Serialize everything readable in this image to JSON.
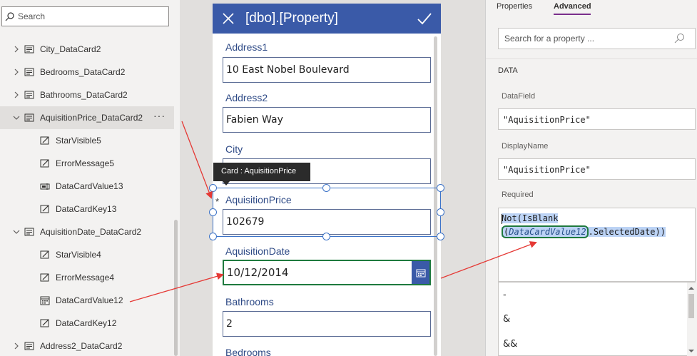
{
  "tree": {
    "search_placeholder": "Search",
    "items": [
      {
        "label": "City_DataCard2",
        "icon": "card-icon"
      },
      {
        "label": "Bedrooms_DataCard2",
        "icon": "card-icon"
      },
      {
        "label": "Bathrooms_DataCard2",
        "icon": "card-icon"
      },
      {
        "label": "AquisitionPrice_DataCard2",
        "icon": "card-icon",
        "selected": true,
        "more": "···"
      },
      {
        "label": "StarVisible5",
        "icon": "edit-label-icon"
      },
      {
        "label": "ErrorMessage5",
        "icon": "edit-label-icon"
      },
      {
        "label": "DataCardValue13",
        "icon": "text-input-icon"
      },
      {
        "label": "DataCardKey13",
        "icon": "edit-label-icon"
      },
      {
        "label": "AquisitionDate_DataCard2",
        "icon": "card-icon"
      },
      {
        "label": "StarVisible4",
        "icon": "edit-label-icon"
      },
      {
        "label": "ErrorMessage4",
        "icon": "edit-label-icon"
      },
      {
        "label": "DataCardValue12",
        "icon": "calendar-icon"
      },
      {
        "label": "DataCardKey12",
        "icon": "edit-label-icon"
      },
      {
        "label": "Address2_DataCard2",
        "icon": "card-icon"
      }
    ]
  },
  "form": {
    "title": "[dbo].[Property]",
    "fields": {
      "address1_label": "Address1",
      "address1_value": "10 East Nobel Boulevard",
      "address2_label": "Address2",
      "address2_value": "Fabien Way",
      "city_label": "City",
      "city_value": "",
      "star": "*",
      "price_label": "AquisitionPrice",
      "price_value": "102679",
      "date_label": "AquisitionDate",
      "date_value": "10/12/2014",
      "bathrooms_label": "Bathrooms",
      "bathrooms_value": "2",
      "bedrooms_label": "Bedrooms"
    },
    "tooltip": "Card : AquisitionPrice"
  },
  "props": {
    "tab_properties": "Properties",
    "tab_advanced": "Advanced",
    "active_tab": "Advanced",
    "search_placeholder": "Search for a property ...",
    "section": "DATA",
    "datafield_label": "DataField",
    "datafield_value": "\"AquisitionPrice\"",
    "displayname_label": "DisplayName",
    "displayname_value": "\"AquisitionPrice\"",
    "required_label": "Required",
    "formula": {
      "part1": "Not(IsBlank",
      "part2_open": "(",
      "part2_param": "DataCardValue12",
      "part2_rest": ".SelectedDate))"
    },
    "suggestions": [
      "-",
      "&",
      "&&"
    ]
  },
  "colors": {
    "header_blue": "#3a5aa8",
    "annotation_red": "#e53935",
    "selection_blue": "#3c73c8",
    "active_green": "#1f7a3e",
    "tab_underline": "#7a2e8b"
  }
}
